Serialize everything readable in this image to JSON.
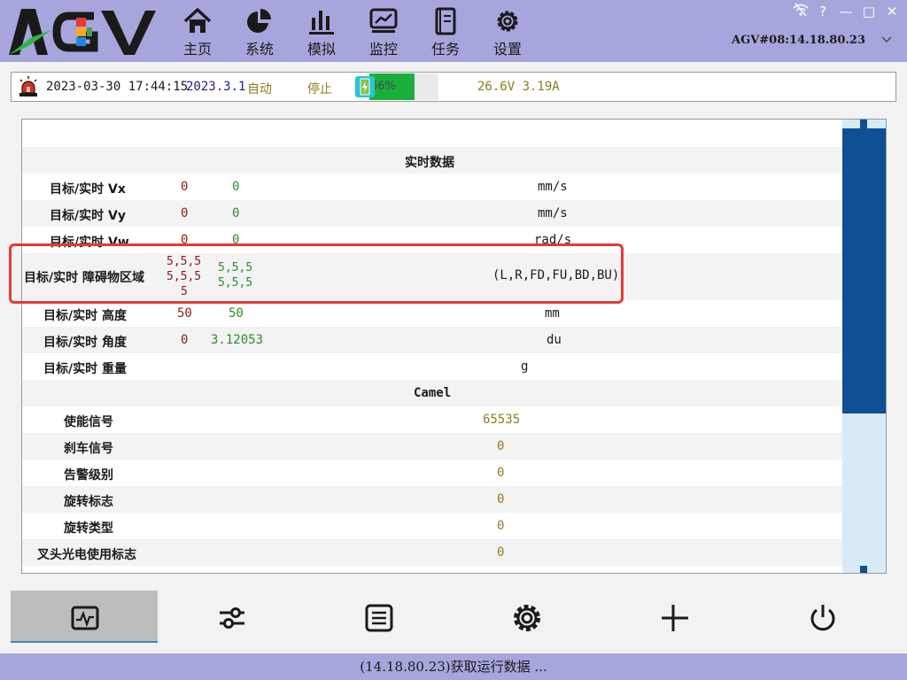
{
  "header": {
    "logo_text": "AGV",
    "nav": [
      {
        "label": "主页",
        "icon": "home-icon"
      },
      {
        "label": "系统",
        "icon": "pie-chart-icon"
      },
      {
        "label": "模拟",
        "icon": "bar-chart-icon"
      },
      {
        "label": "监控",
        "icon": "monitor-chart-icon"
      },
      {
        "label": "任务",
        "icon": "task-list-icon"
      },
      {
        "label": "设置",
        "icon": "gear-icon"
      }
    ],
    "window_controls": {
      "help": "?",
      "minimize": "—",
      "maximize": "□",
      "close": "✕"
    },
    "device_selector": "AGV#08:14.18.80.23"
  },
  "status_bar": {
    "datetime": "2023-03-30 17:44:15",
    "version": "2023.3.1",
    "mode": "自动",
    "state": "停止",
    "battery_percent": 66,
    "battery_text": "66%",
    "voltage_current": "26.6V 3.19A"
  },
  "table": {
    "section_realtime": "实时数据",
    "rows": [
      {
        "label": "目标/实时 Vx",
        "target": "0",
        "actual": "0",
        "unit": "mm/s"
      },
      {
        "label": "目标/实时 Vy",
        "target": "0",
        "actual": "0",
        "unit": "mm/s"
      },
      {
        "label": "目标/实时 Vw",
        "target": "0",
        "actual": "0",
        "unit": "rad/s"
      }
    ],
    "obstacle_row": {
      "label": "目标/实时 障碍物区域",
      "target_line1": "5,5,5",
      "target_line2": "5,5,5",
      "target_line3": "5",
      "actual_line1": "5,5,5",
      "actual_line2": "5,5,5",
      "unit": "(L,R,FD,FU,BD,BU)"
    },
    "rows2": [
      {
        "label": "目标/实时 高度",
        "target": "50",
        "actual": "50",
        "unit": "mm"
      },
      {
        "label": "目标/实时 角度",
        "target": "0",
        "actual": "3.12053",
        "unit": "du"
      },
      {
        "label": "目标/实时 重量",
        "target": "",
        "actual": "",
        "unit": "g"
      }
    ],
    "section_camel": "Camel",
    "camel_rows": [
      {
        "label": "使能信号",
        "value": "65535"
      },
      {
        "label": "刹车信号",
        "value": "0"
      },
      {
        "label": "告警级别",
        "value": "0"
      },
      {
        "label": "旋转标志",
        "value": "0"
      },
      {
        "label": "旋转类型",
        "value": "0"
      },
      {
        "label": "叉头光电使用标志",
        "value": "0"
      }
    ]
  },
  "toolbar": [
    {
      "icon": "activity-monitor-icon",
      "active": true
    },
    {
      "icon": "sliders-icon",
      "active": false
    },
    {
      "icon": "document-icon",
      "active": false
    },
    {
      "icon": "settings-icon",
      "active": false
    },
    {
      "icon": "crosshair-icon",
      "active": false
    },
    {
      "icon": "power-icon",
      "active": false
    }
  ],
  "bottom_status": "(14.18.80.23)获取运行数据 ...",
  "colors": {
    "header_bg": "#a6a6dd",
    "target_value": "#8b1a1a",
    "actual_value": "#2e8b2e",
    "camel_value": "#8b7d1a",
    "scroll_thumb": "#0f4f95",
    "battery_fill": "#1aaf3a",
    "highlight": "#e53935"
  }
}
